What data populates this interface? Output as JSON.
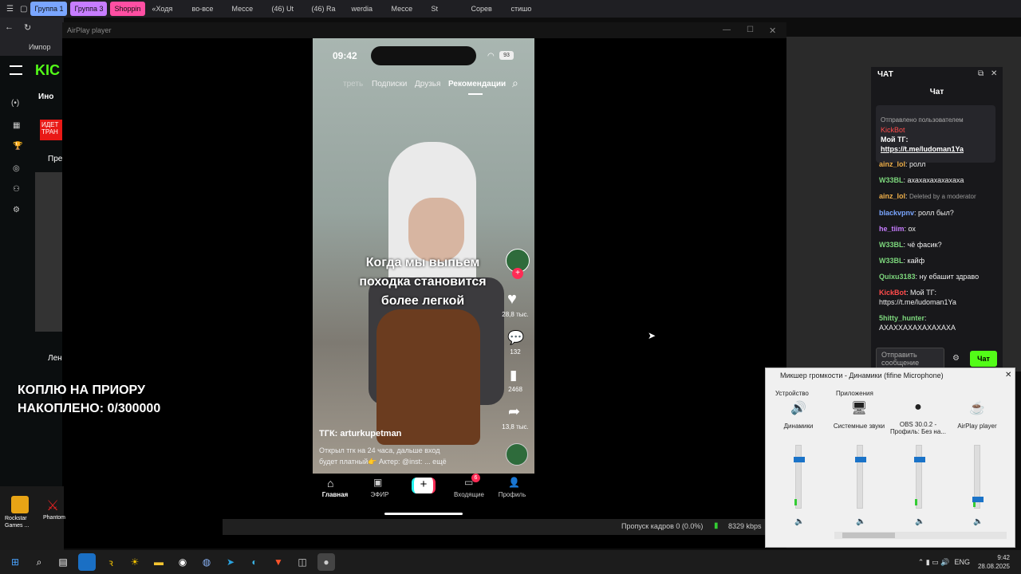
{
  "browser": {
    "tabs": [
      "Группа 1",
      "Группа 3",
      "Shoppin",
      "«Ходя",
      "во-все",
      "Мессе",
      "(46) Ut",
      "(46) Ra",
      "werdia",
      "Мессе",
      "St",
      "Сорев",
      "стишо"
    ],
    "tab_colors": [
      "#7aa6ff",
      "#c77dff",
      "#ff4fa3",
      "#333",
      "#333",
      "#333",
      "#333",
      "#333",
      "#333",
      "#333",
      "#333",
      "#333",
      "#333"
    ],
    "bookmark": "Импор"
  },
  "kick_left": {
    "live_badge": "ИДЕТ ТРАН",
    "sections": [
      "Ино",
      "Пре",
      "Лен"
    ]
  },
  "overlay": {
    "line1": "КОПЛЮ НА ПРИОРУ",
    "line2": "НАКОПЛЕНО: 0/300000"
  },
  "player": {
    "title": "AirPlay player",
    "phone": {
      "time": "09:42",
      "battery": "93",
      "tabs": [
        "треть",
        "Подписки",
        "Друзья",
        "Рекомендации"
      ],
      "caption_lines": [
        "Когда мы выпьем",
        "походка становится",
        "более легкой"
      ],
      "likes": "28,8 тыс.",
      "comments": "132",
      "saves": "2468",
      "shares": "13,8 тыс.",
      "author": "ТГК: arturkupetman",
      "desc1": "Открыл тгк на 24 часа, дальше вход",
      "desc2": "будет платный👉 Актер: @inst: ... ещё",
      "nav": [
        "Главная",
        "ЭФИР",
        "",
        "Входящие",
        "Профиль"
      ],
      "inbox_badge": "6"
    }
  },
  "status": {
    "frames": "Пропуск кадров 0 (0.0%)",
    "bitrate": "8329 kbps"
  },
  "chat": {
    "header": "ЧАТ",
    "subheader": "Чат",
    "pinned_label": "Отправлено пользователем",
    "pinned_user": "KickBot",
    "pinned_text": "Мой ТГ:",
    "pinned_link": "https://t.me/ludoman1Ya",
    "messages": [
      {
        "user": "ainz_lol",
        "color": "#f0b04a",
        "text": "ролл"
      },
      {
        "user": "W33BL",
        "color": "#7cd67c",
        "text": "ахахахахахахаха"
      },
      {
        "user": "ainz_lol",
        "color": "#f0b04a",
        "text": "Deleted by a moderator"
      },
      {
        "user": "blackvpnv",
        "color": "#7aa6ff",
        "text": "ролл был?"
      },
      {
        "user": "he_tiim",
        "color": "#c77dff",
        "text": "ох"
      },
      {
        "user": "W33BL",
        "color": "#7cd67c",
        "text": "чё фасик?"
      },
      {
        "user": "W33BL",
        "color": "#7cd67c",
        "text": "кайф"
      },
      {
        "user": "Quixu3183",
        "color": "#7cd67c",
        "text": "ну ебашит здраво"
      },
      {
        "user": "KickBot",
        "color": "#ff4b4b",
        "text": "Мой ТГ: https://t.me/ludoman1Ya"
      },
      {
        "user": "5hitty_hunter",
        "color": "#7cd67c",
        "text": "АХАХХАХАХАХАХАХА"
      }
    ],
    "input_placeholder": "Отправить сообщение",
    "send": "Чат"
  },
  "mixer": {
    "title": "Микшер громкости - Динамики (fifine Microphone)",
    "device_label": "Устройство",
    "apps_label": "Приложения",
    "columns": [
      "Динамики",
      "Системные звуки",
      "OBS 30.0.2 - Профиль: Без на...",
      "AirPlay player"
    ]
  },
  "desktop": {
    "icon1": "Rockstar Games ...",
    "icon2": "Phantom"
  },
  "taskbar": {
    "lang": "ENG",
    "time": "9:42",
    "date": "28.08.2025"
  }
}
